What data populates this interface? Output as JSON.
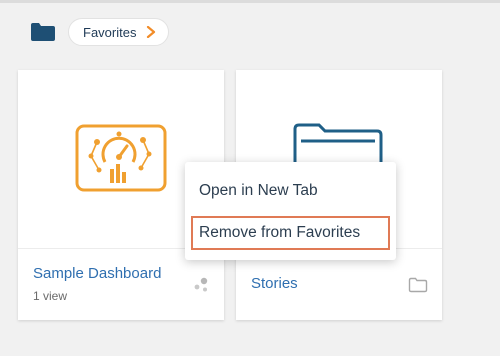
{
  "breadcrumb": {
    "icon": "folder-icon",
    "current": "Favorites",
    "chevron_color": "#f28c28"
  },
  "cards": [
    {
      "title": "Sample Dashboard",
      "subtitle": "1 view",
      "thumbnail_icon": "dashboard-icon",
      "footer_icon": "share-icon",
      "accent": "#f0a030"
    },
    {
      "title": "Stories",
      "thumbnail_icon": "folder-icon",
      "footer_icon": "folder-outline-icon",
      "accent": "#1f5f87"
    }
  ],
  "context_menu": {
    "items": [
      {
        "label": "Open in New Tab"
      },
      {
        "label": "Remove from Favorites",
        "highlighted": true
      }
    ],
    "highlight_color": "#e07a55"
  }
}
